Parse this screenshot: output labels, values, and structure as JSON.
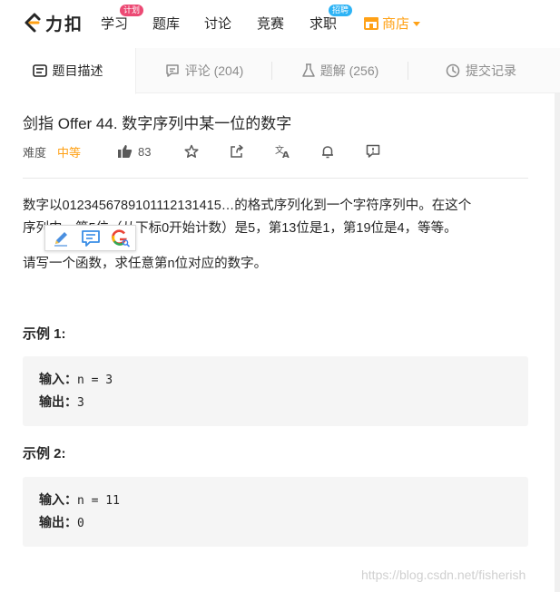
{
  "nav": {
    "logo_text": "力扣",
    "items": [
      {
        "label": "学习",
        "badge": "计划"
      },
      {
        "label": "题库"
      },
      {
        "label": "讨论"
      },
      {
        "label": "竞赛"
      },
      {
        "label": "求职",
        "badge": "招聘"
      }
    ],
    "store_label": "商店"
  },
  "tabs": [
    {
      "label": "题目描述",
      "icon": "description-icon"
    },
    {
      "label": "评论 (204)",
      "icon": "comment-icon"
    },
    {
      "label": "题解 (256)",
      "icon": "flask-icon"
    },
    {
      "label": "提交记录",
      "icon": "clock-icon"
    }
  ],
  "problem": {
    "title": "剑指 Offer 44. 数字序列中某一位的数字",
    "difficulty_label": "难度",
    "difficulty": "中等",
    "likes": "83",
    "description_line1": "数字以0123456789101112131415…的格式序列化到一个字符序列中。在这个",
    "description_line2": "序列中，第5位（从下标0开始计数）是5，第13位是1，第19位是4，等等。",
    "description_line3": "请写一个函数，求任意第n位对应的数字。",
    "examples": [
      {
        "title": "示例 1:",
        "input_label": "输入：",
        "input": "n = 3",
        "output_label": "输出：",
        "output": "3"
      },
      {
        "title": "示例 2:",
        "input_label": "输入：",
        "input": "n = 11",
        "output_label": "输出：",
        "output": "0"
      }
    ]
  },
  "watermark": "https://blog.csdn.net/fisherish",
  "colors": {
    "accent": "#ffa116",
    "badge_pink": "#ec4a74",
    "badge_blue": "#2db3f5"
  }
}
